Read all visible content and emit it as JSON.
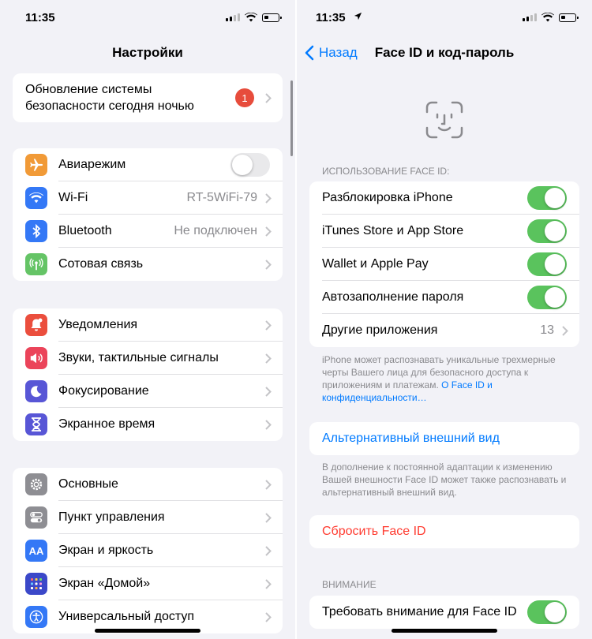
{
  "left": {
    "status_time": "11:35",
    "title": "Настройки",
    "update": {
      "label_line1": "Обновление системы",
      "label_line2": "безопасности сегодня ночью",
      "badge": "1"
    },
    "group1": [
      {
        "label": "Авиарежим",
        "icon": "airplane-icon",
        "color": "#f19a37",
        "toggle": "off"
      },
      {
        "label": "Wi-Fi",
        "value": "RT-5WiFi-79",
        "icon": "wifi-icon",
        "color": "#3478f6"
      },
      {
        "label": "Bluetooth",
        "value": "Не подключен",
        "icon": "bluetooth-icon",
        "color": "#3478f6"
      },
      {
        "label": "Сотовая связь",
        "icon": "cellular-icon",
        "color": "#65c466"
      }
    ],
    "group2": [
      {
        "label": "Уведомления",
        "icon": "bell-icon",
        "color": "#eb4e3d"
      },
      {
        "label": "Звуки, тактильные сигналы",
        "icon": "speaker-icon",
        "color": "#eb445a"
      },
      {
        "label": "Фокусирование",
        "icon": "moon-icon",
        "color": "#5856d6"
      },
      {
        "label": "Экранное время",
        "icon": "hourglass-icon",
        "color": "#5856d6"
      }
    ],
    "group3": [
      {
        "label": "Основные",
        "icon": "gear-icon",
        "color": "#8e8e93"
      },
      {
        "label": "Пункт управления",
        "icon": "switches-icon",
        "color": "#8e8e93"
      },
      {
        "label": "Экран и яркость",
        "icon": "text-size-icon",
        "color": "#3478f6"
      },
      {
        "label": "Экран «Домой»",
        "icon": "home-grid-icon",
        "color": "#3b48c9"
      },
      {
        "label": "Универсальный доступ",
        "icon": "accessibility-icon",
        "color": "#3478f6"
      }
    ]
  },
  "right": {
    "status_time": "11:35",
    "back_label": "Назад",
    "title": "Face ID и код-пароль",
    "use_header": "ИСПОЛЬЗОВАНИЕ FACE ID:",
    "use_rows": [
      {
        "label": "Разблокировка iPhone",
        "toggle": "on"
      },
      {
        "label": "iTunes Store и App Store",
        "toggle": "on"
      },
      {
        "label": "Wallet и Apple Pay",
        "toggle": "on"
      },
      {
        "label": "Автозаполнение пароля",
        "toggle": "on"
      },
      {
        "label": "Другие приложения",
        "value": "13"
      }
    ],
    "use_footer_text": "iPhone может распознавать уникальные трехмерные черты Вашего лица для безопасного доступа к приложениям и платежам. ",
    "use_footer_link": "О Face ID и конфиденциальности…",
    "alt_label": "Альтернативный внешний вид",
    "alt_footer": "В дополнение к постоянной адаптации к изменению Вашей внешности Face ID может также распознавать и альтернативный внешний вид.",
    "reset_label": "Сбросить Face ID",
    "attention_header": "ВНИМАНИЕ",
    "attention_row": {
      "label": "Требовать внимание для Face ID",
      "toggle": "on"
    }
  },
  "colors": {
    "accent": "#007aff",
    "destructive": "#ff3b30",
    "toggle_on": "#5ac35d"
  }
}
